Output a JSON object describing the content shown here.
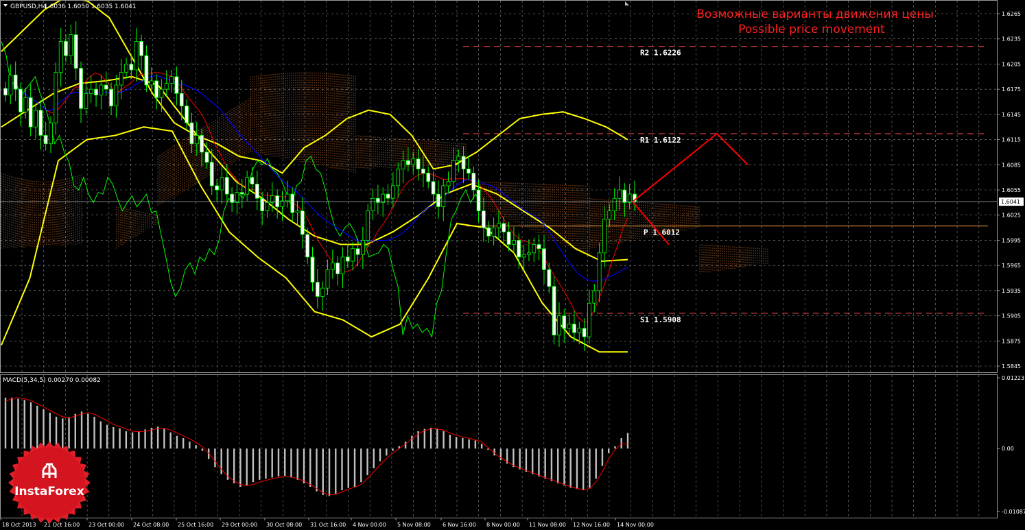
{
  "header": {
    "symbol_label": "GBPUSD,H4",
    "ohlc": "1.6036 1.6050 1.6035 1.6041"
  },
  "annotation": {
    "ru": "Возможные варианты движения цены",
    "en": "Possible price movement"
  },
  "macd_header": "MACD(5,34,5) 0.00270 0.00082",
  "logo_text": "InstaForex",
  "colors": {
    "background": "#000000",
    "grid": "#ffffff",
    "candle": "#00ff00",
    "candle_up_body": "#000000",
    "candle_down_body": "#ffffff",
    "bollinger": "#ffff00",
    "kijun": "#ff0000",
    "tenkun": "#0000ff",
    "chikou": "#00ff00",
    "cloud": "#ff8a3d",
    "levels": "#ff5050",
    "pivot": "#ffa040",
    "forecast": "#ff0000",
    "annotation": "#ff2020",
    "macd_bar": "#c0c0c0",
    "macd_signal": "#ff0000",
    "logo": "#e01e28"
  },
  "chart_data": [
    {
      "type": "candlestick",
      "title": "GBPUSD,H4",
      "symbol": "GBPUSD",
      "timeframe": "H4",
      "grid": true,
      "ylim": [
        1.583,
        1.6285
      ],
      "y_ticks": [
        "1.6265",
        "1.6235",
        "1.6205",
        "1.6175",
        "1.6145",
        "1.6115",
        "1.6085",
        "1.6055",
        "1.6025",
        "1.5995",
        "1.5965",
        "1.5935",
        "1.5905",
        "1.5875",
        "1.5845"
      ],
      "current_price": "1.6041",
      "x_labels": [
        "18 Oct 2013",
        "21 Oct 16:00",
        "23 Oct 00:00",
        "24 Oct 08:00",
        "25 Oct 16:00",
        "29 Oct 00:00",
        "30 Oct 08:00",
        "31 Oct 16:00",
        "4 Nov 00:00",
        "5 Nov 08:00",
        "6 Nov 16:00",
        "8 Nov 00:00",
        "11 Nov 08:00",
        "12 Nov 16:00",
        "14 Nov 00:00"
      ],
      "close_series": [
        1.6168,
        1.6192,
        1.6175,
        1.6148,
        1.6165,
        1.613,
        1.615,
        1.612,
        1.611,
        1.6135,
        1.6195,
        1.6232,
        1.6215,
        1.624,
        1.62,
        1.6152,
        1.617,
        1.6175,
        1.6168,
        1.618,
        1.6175,
        1.6155,
        1.618,
        1.6195,
        1.6205,
        1.6198,
        1.6232,
        1.6215,
        1.618,
        1.6185,
        1.6165,
        1.6175,
        1.6182,
        1.619,
        1.617,
        1.6155,
        1.6135,
        1.611,
        1.612,
        1.61,
        1.6088,
        1.606,
        1.6055,
        1.607,
        1.605,
        1.604,
        1.6052,
        1.605,
        1.607,
        1.6062,
        1.6045,
        1.603,
        1.604,
        1.6048,
        1.6035,
        1.6042,
        1.605,
        1.6028,
        1.603,
        1.6002,
        1.5975,
        1.5945,
        1.5928,
        1.5938,
        1.596,
        1.5968,
        1.5955,
        1.5975,
        1.597,
        1.5985,
        1.5978,
        1.5995,
        1.603,
        1.6045,
        1.604,
        1.605,
        1.6045,
        1.606,
        1.608,
        1.609,
        1.6085,
        1.6092,
        1.608,
        1.6075,
        1.6065,
        1.605,
        1.6035,
        1.606,
        1.6065,
        1.609,
        1.6095,
        1.608,
        1.6075,
        1.6055,
        1.603,
        1.601,
        1.6,
        1.601,
        1.6015,
        1.6005,
        1.599,
        1.5995,
        1.5975,
        1.5978,
        1.598,
        1.599,
        1.5985,
        1.596,
        1.594,
        1.5882,
        1.5905,
        1.589,
        1.5895,
        1.5885,
        1.589,
        1.588,
        1.592,
        1.5935,
        1.598,
        1.602,
        1.603,
        1.6045,
        1.6055,
        1.604,
        1.605,
        1.6041
      ],
      "bollinger_upper": [
        1.622,
        1.6245,
        1.627,
        1.6285,
        1.628,
        1.626,
        1.6215,
        1.617,
        1.6135,
        1.612,
        1.611,
        1.6095,
        1.609,
        1.6075,
        1.6105,
        1.612,
        1.614,
        1.615,
        1.6145,
        1.612,
        1.608,
        1.6085,
        1.61,
        1.612,
        1.614,
        1.6145,
        1.6148,
        1.614,
        1.613,
        1.6115
      ],
      "bollinger_mid": [
        1.613,
        1.615,
        1.617,
        1.6182,
        1.6185,
        1.619,
        1.618,
        1.614,
        1.61,
        1.6065,
        1.6045,
        1.602,
        1.6,
        1.599,
        1.599,
        1.6005,
        1.6025,
        1.605,
        1.6062,
        1.605,
        1.603,
        1.601,
        1.5985,
        1.597,
        1.5972
      ],
      "bollinger_lower": [
        1.587,
        1.595,
        1.609,
        1.6115,
        1.612,
        1.613,
        1.6125,
        1.606,
        1.6005,
        1.5975,
        1.595,
        1.591,
        1.59,
        1.588,
        1.5895,
        1.595,
        1.6015,
        1.601,
        1.598,
        1.592,
        1.588,
        1.5862,
        1.5862
      ],
      "ichimoku": {
        "tenkan_sen": "blue",
        "kijun_sen": "red",
        "chikou_span": "green",
        "kumo": "dotted"
      },
      "levels": [
        {
          "name": "R2",
          "value": 1.6226,
          "label": "R2 1.6226"
        },
        {
          "name": "R1",
          "value": 1.6122,
          "label": "R1 1.6122"
        },
        {
          "name": "P",
          "value": 1.6012,
          "label": "P 1.6012"
        },
        {
          "name": "S1",
          "value": 1.5908,
          "label": "S1 1.5908"
        }
      ],
      "forecast": [
        {
          "name": "up",
          "points": [
            [
              "14 Nov 00:00",
              1.6041
            ],
            [
              "R1",
              1.6122
            ],
            [
              "after",
              1.6085
            ]
          ]
        },
        {
          "name": "down",
          "points": [
            [
              "14 Nov 00:00",
              1.6041
            ],
            [
              "P",
              1.599
            ]
          ]
        }
      ]
    },
    {
      "type": "bar",
      "title": "MACD(5,34,5) 0.00270 0.00082",
      "indicator": "MACD",
      "params": [
        5,
        34,
        5
      ],
      "main_value": 0.0027,
      "signal_value": 0.00082,
      "ylim": [
        -0.01087,
        0.01223
      ],
      "y_ticks": [
        "0.01223",
        "0.00",
        "-0.01087"
      ],
      "histogram": [
        0.0088,
        0.0088,
        0.0086,
        0.0084,
        0.008,
        0.0074,
        0.0068,
        0.0062,
        0.0055,
        0.0052,
        0.0054,
        0.006,
        0.0064,
        0.006,
        0.0055,
        0.0047,
        0.0041,
        0.0037,
        0.0035,
        0.003,
        0.0028,
        0.003,
        0.0033,
        0.0036,
        0.0038,
        0.0034,
        0.0028,
        0.0022,
        0.0018,
        0.0012,
        0.0006,
        -0.0004,
        -0.0018,
        -0.0032,
        -0.0044,
        -0.0054,
        -0.006,
        -0.0066,
        -0.0064,
        -0.0058,
        -0.0054,
        -0.0052,
        -0.005,
        -0.0048,
        -0.0047,
        -0.005,
        -0.0054,
        -0.006,
        -0.0066,
        -0.0074,
        -0.008,
        -0.0082,
        -0.0078,
        -0.0072,
        -0.0068,
        -0.0066,
        -0.0058,
        -0.0046,
        -0.0034,
        -0.0022,
        -0.0012,
        -0.0004,
        0.0004,
        0.0012,
        0.0022,
        0.003,
        0.0034,
        0.0036,
        0.0034,
        0.003,
        0.0024,
        0.002,
        0.0018,
        0.0016,
        0.0014,
        0.0008,
        -0.0002,
        -0.0012,
        -0.002,
        -0.0026,
        -0.0032,
        -0.0036,
        -0.004,
        -0.0044,
        -0.0048,
        -0.0052,
        -0.0056,
        -0.006,
        -0.0064,
        -0.0068,
        -0.007,
        -0.0072,
        -0.0068,
        -0.0052,
        -0.003,
        -0.0008,
        0.0004,
        0.0018,
        0.0027
      ],
      "signal": [
        0.0082,
        0.0086,
        0.0088,
        0.0086,
        0.0083,
        0.0078,
        0.0072,
        0.0066,
        0.006,
        0.0055,
        0.0053,
        0.0056,
        0.006,
        0.0062,
        0.0059,
        0.0054,
        0.0048,
        0.0042,
        0.0038,
        0.0034,
        0.003,
        0.0029,
        0.003,
        0.0032,
        0.0035,
        0.0035,
        0.0032,
        0.0027,
        0.0022,
        0.0017,
        0.0011,
        0.0003,
        -0.0008,
        -0.0022,
        -0.0036,
        -0.0048,
        -0.0056,
        -0.0062,
        -0.0064,
        -0.0062,
        -0.0058,
        -0.0055,
        -0.0052,
        -0.005,
        -0.0048,
        -0.0049,
        -0.0052,
        -0.0056,
        -0.0062,
        -0.0069,
        -0.0076,
        -0.008,
        -0.0079,
        -0.0075,
        -0.007,
        -0.0067,
        -0.0062,
        -0.0052,
        -0.004,
        -0.0028,
        -0.0017,
        -0.0008,
        0.0,
        0.0008,
        0.0017,
        0.0025,
        0.0031,
        0.0034,
        0.0034,
        0.0032,
        0.0027,
        0.0023,
        0.002,
        0.0018,
        0.0015,
        0.0011,
        0.0002,
        -0.0008,
        -0.0016,
        -0.0023,
        -0.0029,
        -0.0034,
        -0.0038,
        -0.0042,
        -0.0046,
        -0.005,
        -0.0054,
        -0.0058,
        -0.0062,
        -0.0066,
        -0.0069,
        -0.0071,
        -0.0069,
        -0.0058,
        -0.004,
        -0.0018,
        -0.0002,
        0.0008,
        0.0008
      ]
    }
  ]
}
